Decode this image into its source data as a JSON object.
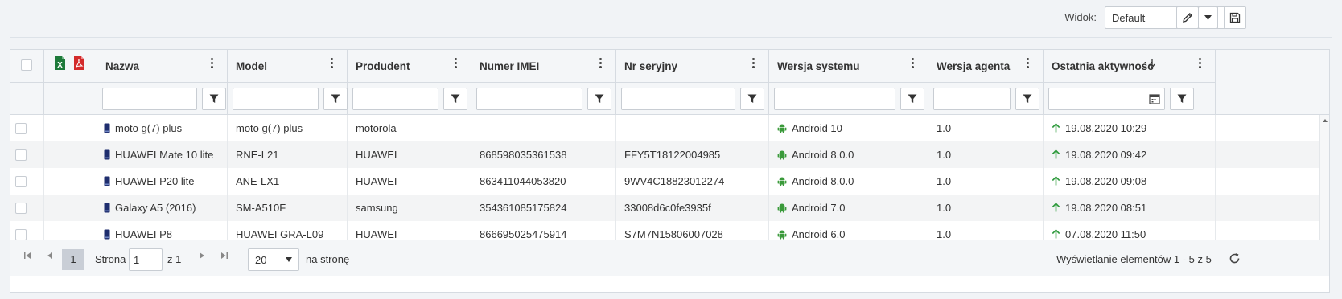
{
  "toolbar": {
    "view_label": "Widok:",
    "view_value": "Default",
    "edit_icon": "pencil-icon",
    "dropdown_icon": "caret-down-icon",
    "save_icon": "floppy-disk-icon"
  },
  "grid": {
    "export_icons": [
      "excel-icon",
      "pdf-icon"
    ],
    "columns": [
      {
        "label": "Nazwa"
      },
      {
        "label": "Model"
      },
      {
        "label": "Produdent"
      },
      {
        "label": "Numer IMEI"
      },
      {
        "label": "Nr seryjny"
      },
      {
        "label": "Wersja systemu"
      },
      {
        "label": "Wersja agenta"
      },
      {
        "label": "Ostatnia aktywność",
        "sorted": "desc"
      }
    ],
    "rows": [
      {
        "name": "moto g(7) plus",
        "model": "moto g(7) plus",
        "producer": "motorola",
        "imei": "",
        "serial": "",
        "os": "Android 10",
        "agent": "1.0",
        "last_active": "19.08.2020 10:29"
      },
      {
        "name": "HUAWEI Mate 10 lite",
        "model": "RNE-L21",
        "producer": "HUAWEI",
        "imei": "868598035361538",
        "serial": "FFY5T18122004985",
        "os": "Android 8.0.0",
        "agent": "1.0",
        "last_active": "19.08.2020 09:42"
      },
      {
        "name": "HUAWEI P20 lite",
        "model": "ANE-LX1",
        "producer": "HUAWEI",
        "imei": "863411044053820",
        "serial": "9WV4C18823012274",
        "os": "Android 8.0.0",
        "agent": "1.0",
        "last_active": "19.08.2020 09:08"
      },
      {
        "name": "Galaxy A5 (2016)",
        "model": "SM-A510F",
        "producer": "samsung",
        "imei": "354361085175824",
        "serial": "33008d6c0fe3935f",
        "os": "Android 7.0",
        "agent": "1.0",
        "last_active": "19.08.2020 08:51"
      },
      {
        "name": "HUAWEI P8",
        "model": "HUAWEI GRA-L09",
        "producer": "HUAWEI",
        "imei": "866695025475914",
        "serial": "S7M7N15806007028",
        "os": "Android 6.0",
        "agent": "1.0",
        "last_active": "07.08.2020 11:50"
      }
    ]
  },
  "pager": {
    "current_page": "1",
    "page_label": "Strona",
    "page_input": "1",
    "of_label": "z 1",
    "page_size": "20",
    "per_page_label": "na stronę",
    "summary": "Wyświetlanie elementów 1 - 5 z 5"
  },
  "colors": {
    "android_green": "#3a9a3a",
    "arrow_green": "#2e9a3c",
    "phone_navy": "#1f2e6e",
    "excel_green": "#1e7a3a",
    "pdf_red": "#d32b2b"
  }
}
